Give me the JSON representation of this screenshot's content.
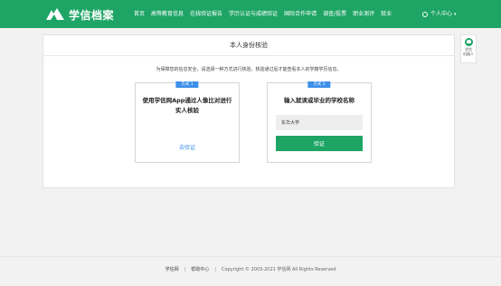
{
  "header": {
    "logo_text": "学信档案",
    "nav": [
      "首页",
      "高等教育信息",
      "在线验证报告",
      "学历认证与成绩验证",
      "国际合作申请",
      "调查/投票",
      "职业测评",
      "就业"
    ],
    "user_label": "个人中心",
    "colors": {
      "brand": "#1ea565"
    }
  },
  "card": {
    "title": "本人身份核验",
    "notice": "为保障您的信息安全，请选择一种方式进行核验，核验通过后才能查看本人的学籍学历信息。"
  },
  "option1": {
    "badge": "方式 1",
    "title": "使用学信网App通过人像比对进行实人核验",
    "link": "去验证"
  },
  "option2": {
    "badge": "方式 2",
    "title": "输入就读或毕业的学校名称",
    "input_value": "东华大学",
    "button": "验证"
  },
  "float_widget": {
    "line1": "学信",
    "line2": "机器人"
  },
  "footer": {
    "link1": "学信网",
    "link2": "帮助中心",
    "copyright": "Copyright © 2003-2021 学信网 All Rights Reserved"
  }
}
